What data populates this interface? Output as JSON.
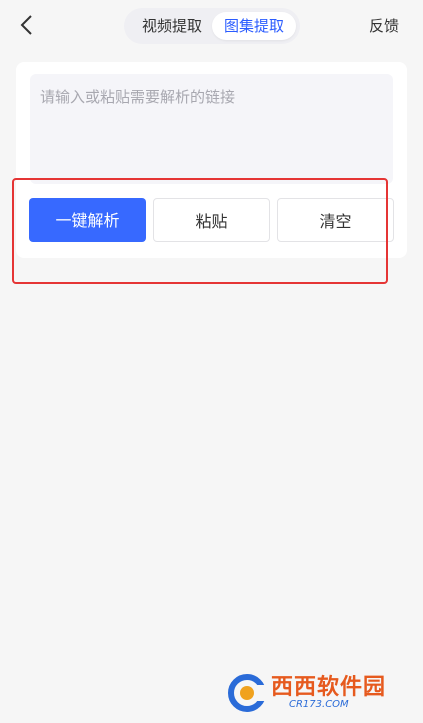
{
  "header": {
    "tabs": [
      {
        "label": "视频提取",
        "active": false
      },
      {
        "label": "图集提取",
        "active": true
      }
    ],
    "feedback_label": "反馈",
    "back_icon": "chevron-left-icon"
  },
  "input": {
    "placeholder": "请输入或粘贴需要解析的链接",
    "value": ""
  },
  "actions": {
    "parse_label": "一键解析",
    "paste_label": "粘贴",
    "clear_label": "清空"
  },
  "watermark": {
    "brand": "西西软件园",
    "site": "CR173.COM"
  },
  "colors": {
    "accent": "#3769ff",
    "active_tab_text": "#2b5cff",
    "highlight": "#e53535",
    "background": "#f6f6f6"
  }
}
